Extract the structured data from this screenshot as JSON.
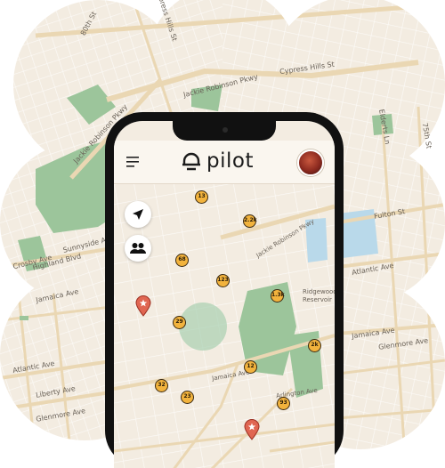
{
  "app": {
    "name": "pilot",
    "menu_icon": "hamburger-menu-icon",
    "logo_icon": "pilot-logo-icon",
    "avatar_icon": "user-avatar"
  },
  "background_map": {
    "street_labels": {
      "jackie_robinson_top": "Jackie Robinson Pkwy",
      "jackie_robinson_diag": "Jackie Robinson Pkwy",
      "cypress_hills": "Cypress Hills St",
      "highland_blvd": "Highland Blvd",
      "sunnyside": "Sunnyside Ave",
      "jamaica_ave": "Jamaica Ave",
      "atlantic_ave_left": "Atlantic Ave",
      "liberty_ave": "Liberty Ave",
      "glenmore_ave": "Glenmore Ave",
      "crosby_ave": "Crosby Ave",
      "fulton_st": "Fulton St",
      "atlantic_ave_right": "Atlantic Ave",
      "jamaica_ave_right": "Jamaica Ave",
      "glenmore_ave_right": "Glenmore Ave",
      "elderts_ln": "Elderts Ln",
      "ridgewood": "Ridgewood",
      "reservoir": "Reservoir",
      "street_80th": "80th St",
      "street_75th": "75th St",
      "arlington": "Arlington Ave"
    }
  },
  "controls": {
    "locate_icon": "navigation-arrow-icon",
    "group_icon": "group-users-icon"
  },
  "clusters": [
    "13",
    "2.2k",
    "68",
    "123",
    "1.3k",
    "29",
    "2k",
    "12",
    "32",
    "23",
    "93"
  ],
  "pins": {
    "icon": "map-pin-star-icon",
    "count": 2
  },
  "colors": {
    "map_base": "#f3ece1",
    "park": "#9cc59b",
    "water": "#b9d9ea",
    "road": "#ead7b3",
    "cluster_fill": "#f2b33d",
    "pin": "#e06652",
    "phone_frame": "#111111"
  }
}
